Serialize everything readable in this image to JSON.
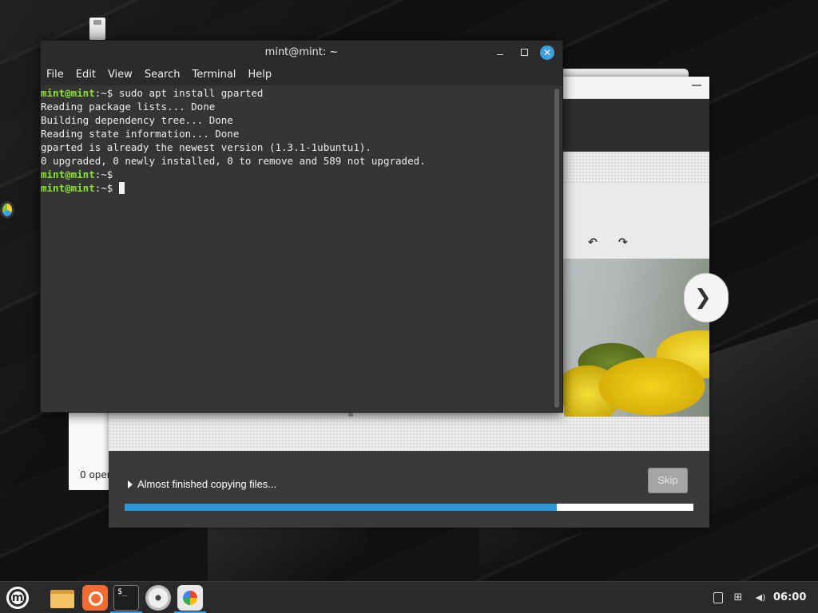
{
  "terminal": {
    "title": "mint@mint: ~",
    "close_glyph": "✕",
    "menu": [
      "File",
      "Edit",
      "View",
      "Search",
      "Terminal",
      "Help"
    ],
    "lines": [
      {
        "prompt": "mint@mint",
        "path": ":~$ ",
        "text": "sudo apt install gparted"
      },
      {
        "prompt": "",
        "path": "",
        "text": "Reading package lists... Done"
      },
      {
        "prompt": "",
        "path": "",
        "text": "Building dependency tree... Done"
      },
      {
        "prompt": "",
        "path": "",
        "text": "Reading state information... Done"
      },
      {
        "prompt": "",
        "path": "",
        "text": "gparted is already the newest version (1.3.1-1ubuntu1)."
      },
      {
        "prompt": "",
        "path": "",
        "text": "0 upgraded, 0 newly installed, 0 to remove and 589 not upgraded."
      },
      {
        "prompt": "mint@mint",
        "path": ":~$ ",
        "text": ""
      },
      {
        "prompt": "mint@mint",
        "path": ":~$ ",
        "text": ""
      }
    ]
  },
  "installer": {
    "background_status": "0 oper",
    "progress_text": "Almost finished copying files...",
    "skip_label": "Skip",
    "progress_fraction": 0.76,
    "next_glyph": "❯",
    "rotate_left_glyph": "↶",
    "rotate_right_glyph": "↷"
  },
  "taskbar": {
    "menu_glyph": "m",
    "terminal_glyph": "$_",
    "tray_network_glyph": "⊞",
    "tray_volume_glyph": "◀)",
    "clock": "06:00"
  },
  "colors": {
    "accent": "#3d9ee0",
    "prompt_green": "#8ae234",
    "progress_blue": "#2c97d8"
  }
}
